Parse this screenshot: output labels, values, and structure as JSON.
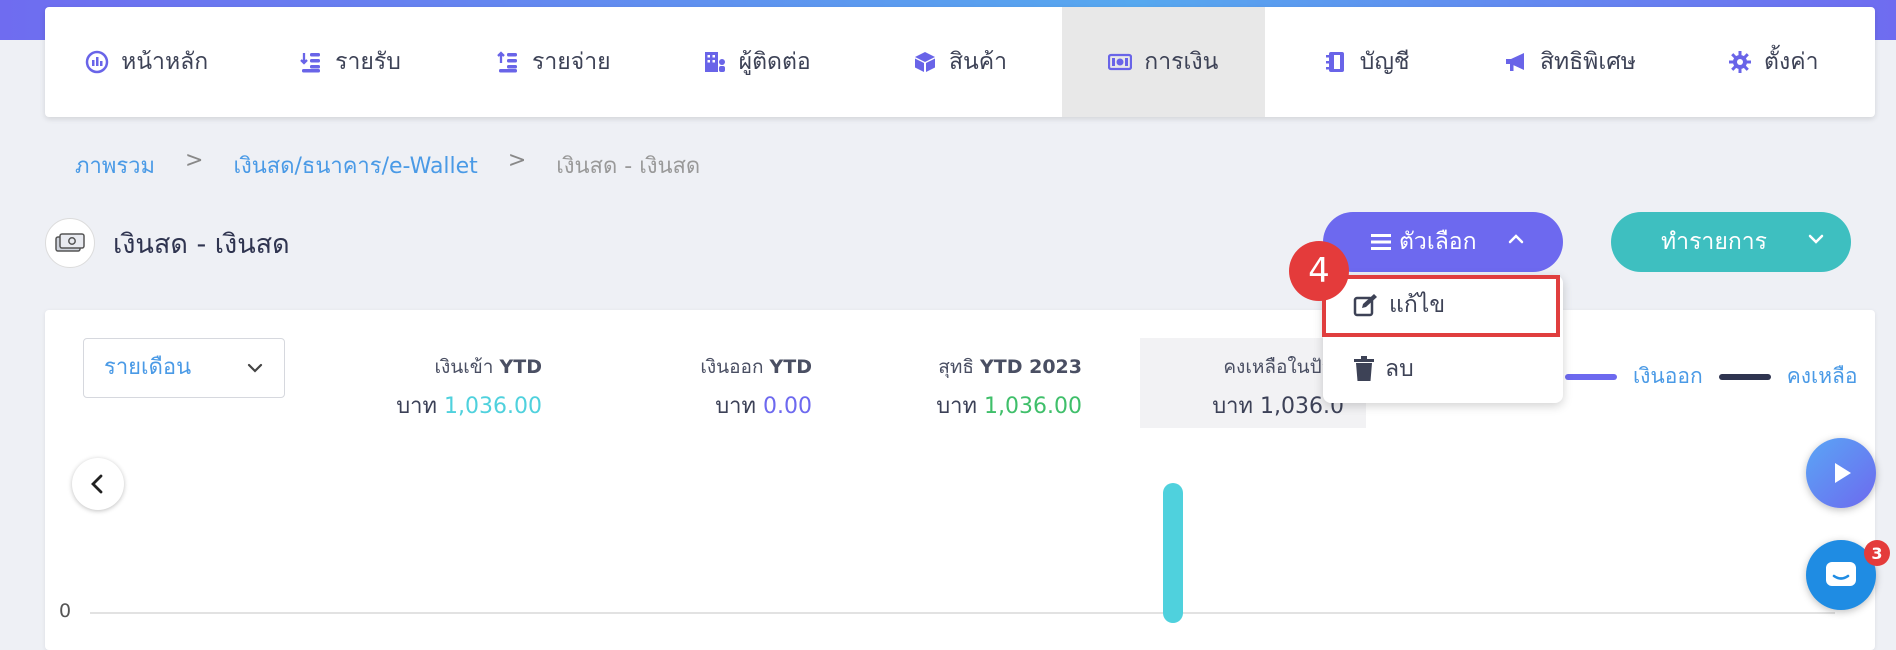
{
  "nav": {
    "items": [
      {
        "label": "หน้าหลัก",
        "icon": "dashboard-gauge-icon"
      },
      {
        "label": "รายรับ",
        "icon": "income-coins-icon"
      },
      {
        "label": "รายจ่าย",
        "icon": "expense-coins-icon"
      },
      {
        "label": "ผู้ติดต่อ",
        "icon": "contacts-building-icon"
      },
      {
        "label": "สินค้า",
        "icon": "product-box-icon"
      },
      {
        "label": "การเงิน",
        "icon": "money-bill-icon",
        "active": true
      },
      {
        "label": "บัญชี",
        "icon": "ledger-book-icon"
      },
      {
        "label": "สิทธิพิเศษ",
        "icon": "megaphone-icon"
      },
      {
        "label": "ตั้งค่า",
        "icon": "gear-icon"
      }
    ]
  },
  "breadcrumb": {
    "items": [
      "ภาพรวม",
      "เงินสด/ธนาคาร/e-Wallet",
      "เงินสด - เงินสด"
    ],
    "separator": ">"
  },
  "page": {
    "title": "เงินสด - เงินสด",
    "avatar_icon": "cash-stack-icon"
  },
  "actions": {
    "options_label": "ตัวเลือก",
    "transact_label": "ทำรายการ"
  },
  "options_menu": {
    "items": [
      {
        "label": "แก้ไข",
        "icon": "edit-icon"
      },
      {
        "label": "ลบ",
        "icon": "trash-icon"
      }
    ]
  },
  "annotation": {
    "step": "4",
    "color": "#e03e3e"
  },
  "filters": {
    "period_value": "รายเดือน"
  },
  "summary": {
    "stats": [
      {
        "label": "เงินเข้า",
        "label_bold": "YTD",
        "currency": "บาท",
        "value": "1,036.00",
        "color": "#4fd1dd"
      },
      {
        "label": "เงินออก",
        "label_bold": "YTD",
        "currency": "บาท",
        "value": "0.00",
        "color": "#6d69ef"
      },
      {
        "label": "สุทธิ",
        "label_bold": "YTD 2023",
        "currency": "บาท",
        "value": "1,036.00",
        "color": "#3fbf6a"
      },
      {
        "label": "คงเหลือในปัจจุ",
        "label_bold": "",
        "currency": "บาท",
        "value": "1,036.0",
        "color": "#3c4157"
      }
    ]
  },
  "legend": {
    "items": [
      {
        "label": "เงินออก",
        "color": "#6d69ef"
      },
      {
        "label": "คงเหลือ",
        "color": "#2f3450"
      }
    ]
  },
  "chart_data": {
    "type": "bar",
    "yticks": [
      "0"
    ],
    "series": [
      {
        "name": "เงินเข้า",
        "color": "#4fd1dd",
        "values": [
          1036
        ]
      }
    ]
  },
  "chat": {
    "badge_count": "3"
  }
}
